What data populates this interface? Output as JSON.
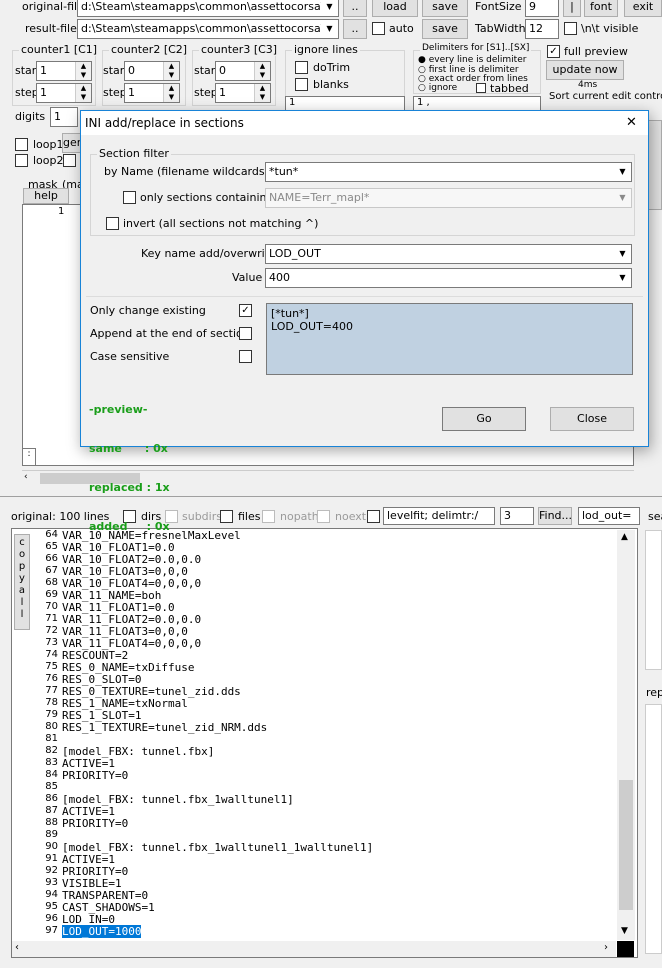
{
  "top": {
    "original_label": "original-file:",
    "original_value": "d:\\Steam\\steamapps\\common\\assettocorsa\\conte",
    "result_label": "result-file:",
    "result_value": "d:\\Steam\\steamapps\\common\\assettocorsa\\exter",
    "dots1": "..",
    "dots2": "..",
    "load": "load",
    "save1": "save",
    "save2": "save",
    "fontsize_label": "FontSize",
    "fontsize_value": "9",
    "font_btn": "font",
    "exit_btn": "exit",
    "pipe_btn": "|",
    "auto_label": "auto",
    "tabwidth_label": "TabWidth",
    "tabwidth_value": "12",
    "ntvisible_label": "\\n\\t visible"
  },
  "counters": [
    {
      "title": "counter1 [C1]",
      "start": "1",
      "step": "1"
    },
    {
      "title": "counter2 [C2]",
      "start": "0",
      "step": "1"
    },
    {
      "title": "counter3 [C3]",
      "start": "0",
      "step": "1"
    }
  ],
  "start_label": "start",
  "step_label": "step",
  "digits_label": "digits",
  "digits_value": "1",
  "ignore": {
    "title": "ignore lines",
    "dotrim": "doTrim",
    "blanks": "blanks",
    "value": "1"
  },
  "delims": {
    "title": "Delimiters for [S1]..[SX]",
    "o1": "every line is delimiter",
    "o2": "first line is delimiter",
    "o3": "exact order from lines",
    "o4": "ignore",
    "tabbed": "tabbed",
    "value": "1 ,"
  },
  "preview": {
    "full": "full preview",
    "update": "update now",
    "ms": "4ms",
    "sort": "Sort current edit control"
  },
  "loops": {
    "loop1": "loop1",
    "loop2": "loop2",
    "gen": "ger"
  },
  "mask": {
    "label": "mask",
    "label2": "(ma",
    "help": "help",
    "line": "1"
  },
  "dialog": {
    "title": "INI add/replace in sections",
    "close_x": "✕",
    "section_filter": "Section filter",
    "by_name_label": "by Name (filename wildcards ? *)",
    "by_name_value": "*tun*",
    "only_sections_label": "only sections containing:",
    "only_sections_value": "NAME=Terr_mapl*",
    "invert_label": "invert (all sections not matching ^)",
    "key_label": "Key name add/overwrite",
    "key_value": "LOD_OUT",
    "value_label": "Value",
    "value_value": "400",
    "only_change": "Only change existing",
    "append_end": "Append at the end of section",
    "case_sensitive": "Case sensitive",
    "preview_lines": [
      "[*tun*]",
      "LOD_OUT=400"
    ],
    "stats": [
      "-preview-",
      "same      : 0x",
      "replaced : 1x",
      "added     : 0x"
    ],
    "go": "Go",
    "close": "Close"
  },
  "status": {
    "original": "original: 100 lines",
    "dirs": "dirs",
    "subdirs": "subdirs",
    "files": "files",
    "nopath": "nopath",
    "noext": "noext",
    "levelfit": "levelfit; delimtr:/",
    "num": "3",
    "find": "Find...",
    "lodout": "lod_out=",
    "sea": "sea",
    "rep": "rep"
  },
  "copyall": [
    "c",
    "o",
    "p",
    "y",
    "a",
    "l",
    "l"
  ],
  "lines": [
    {
      "n": "64",
      "t": "VAR_10_NAME=fresnelMaxLevel"
    },
    {
      "n": "65",
      "t": "VAR_10_FLOAT1=0.0"
    },
    {
      "n": "66",
      "t": "VAR_10_FLOAT2=0.0,0.0"
    },
    {
      "n": "67",
      "t": "VAR_10_FLOAT3=0,0,0"
    },
    {
      "n": "68",
      "t": "VAR_10_FLOAT4=0,0,0,0"
    },
    {
      "n": "69",
      "t": "VAR_11_NAME=boh"
    },
    {
      "n": "70",
      "t": "VAR_11_FLOAT1=0.0"
    },
    {
      "n": "71",
      "t": "VAR_11_FLOAT2=0.0,0.0"
    },
    {
      "n": "72",
      "t": "VAR_11_FLOAT3=0,0,0"
    },
    {
      "n": "73",
      "t": "VAR_11_FLOAT4=0,0,0,0"
    },
    {
      "n": "74",
      "t": "RESCOUNT=2"
    },
    {
      "n": "75",
      "t": "RES_0_NAME=txDiffuse"
    },
    {
      "n": "76",
      "t": "RES_0_SLOT=0"
    },
    {
      "n": "77",
      "t": "RES_0_TEXTURE=tunel_zid.dds"
    },
    {
      "n": "78",
      "t": "RES_1_NAME=txNormal"
    },
    {
      "n": "79",
      "t": "RES_1_SLOT=1"
    },
    {
      "n": "80",
      "t": "RES_1_TEXTURE=tunel_zid_NRM.dds"
    },
    {
      "n": "81",
      "t": ""
    },
    {
      "n": "82",
      "t": "[model_FBX: tunnel.fbx]"
    },
    {
      "n": "83",
      "t": "ACTIVE=1"
    },
    {
      "n": "84",
      "t": "PRIORITY=0"
    },
    {
      "n": "85",
      "t": ""
    },
    {
      "n": "86",
      "t": "[model_FBX: tunnel.fbx_1walltunel1]"
    },
    {
      "n": "87",
      "t": "ACTIVE=1"
    },
    {
      "n": "88",
      "t": "PRIORITY=0"
    },
    {
      "n": "89",
      "t": ""
    },
    {
      "n": "90",
      "t": "[model_FBX: tunnel.fbx_1walltunel1_1walltunel1]"
    },
    {
      "n": "91",
      "t": "ACTIVE=1"
    },
    {
      "n": "92",
      "t": "PRIORITY=0"
    },
    {
      "n": "93",
      "t": "VISIBLE=1"
    },
    {
      "n": "94",
      "t": "TRANSPARENT=0"
    },
    {
      "n": "95",
      "t": "CAST_SHADOWS=1"
    },
    {
      "n": "96",
      "t": "LOD_IN=0"
    },
    {
      "n": "97",
      "t": "LOD_OUT=1000"
    }
  ]
}
